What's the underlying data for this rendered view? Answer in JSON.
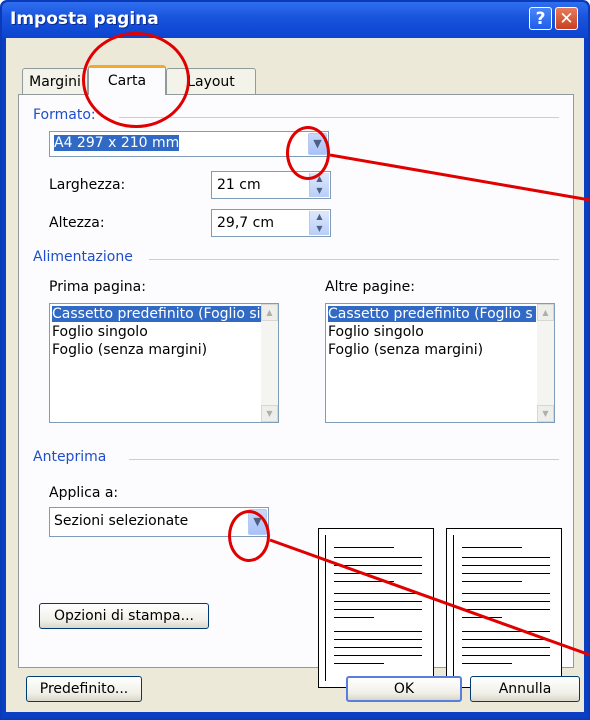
{
  "window": {
    "title": "Imposta pagina",
    "help_glyph": "?",
    "close_glyph": "✕"
  },
  "tabs": [
    {
      "label": "Margini",
      "selected": false
    },
    {
      "label": "Carta",
      "selected": true
    },
    {
      "label": "Layout",
      "selected": false
    }
  ],
  "formato": {
    "group_label": "Formato:",
    "paper_size_value": "A4 297 x 210 mm",
    "larghezza_label": "Larghezza:",
    "larghezza_value": "21 cm",
    "altezza_label": "Altezza:",
    "altezza_value": "29,7 cm"
  },
  "alimentazione": {
    "group_label": "Alimentazione",
    "prima_pagina_label": "Prima pagina:",
    "altre_pagine_label": "Altre pagine:",
    "prima_items": [
      "Cassetto predefinito (Foglio si",
      "Foglio singolo",
      "Foglio (senza margini)"
    ],
    "altre_items": [
      "Cassetto predefinito (Foglio s",
      "Foglio singolo",
      "Foglio (senza margini)"
    ],
    "selected_index": 0
  },
  "anteprima": {
    "group_label": "Anteprima",
    "applica_label": "Applica a:",
    "applica_value": "Sezioni selezionate",
    "opzioni_button": "Opzioni di stampa..."
  },
  "footer": {
    "predefinito_button": "Predefinito...",
    "ok_button": "OK",
    "annulla_button": "Annulla"
  },
  "icons": {
    "dropdown": "chevron-down-icon",
    "spin": "spin-arrows-icon"
  },
  "colors": {
    "titlebar": "#0b44cf",
    "selection": "#316ac5",
    "group_label": "#1f4fc8",
    "annotation": "#e00000",
    "tab_highlight": "#f3a82f"
  }
}
